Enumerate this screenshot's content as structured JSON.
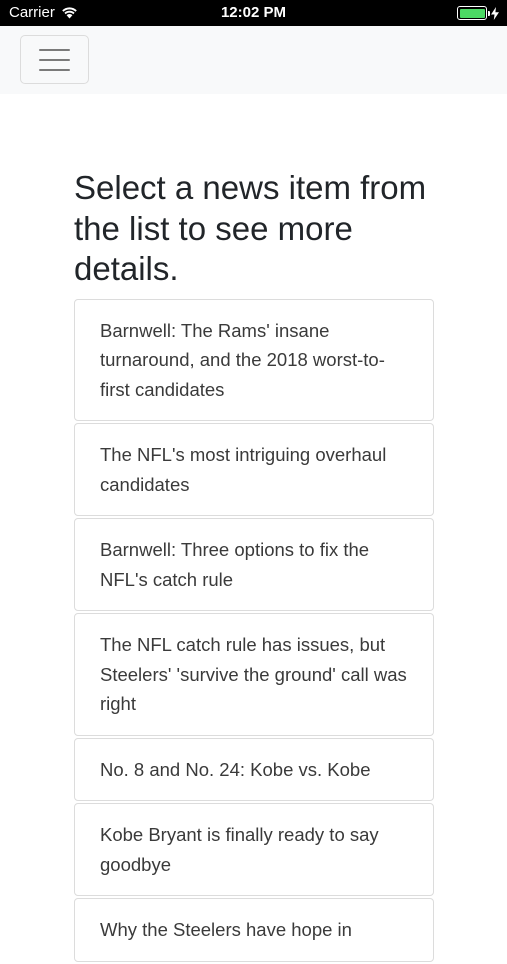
{
  "status_bar": {
    "carrier": "Carrier",
    "time": "12:02 PM",
    "battery_color": "#4cd964"
  },
  "navbar": {
    "toggler_icon": "hamburger-menu-icon"
  },
  "main": {
    "heading": "Select a news item from the list to see more details.",
    "news_items": [
      "Barnwell: The Rams' insane turnaround, and the 2018 worst-to-first candidates",
      "The NFL's most intriguing overhaul candidates",
      "Barnwell: Three options to fix the NFL's catch rule",
      "The NFL catch rule has issues, but Steelers' 'survive the ground' call was right",
      "No. 8 and No. 24: Kobe vs. Kobe",
      "Kobe Bryant is finally ready to say goodbye",
      "Why the Steelers have hope in"
    ]
  }
}
